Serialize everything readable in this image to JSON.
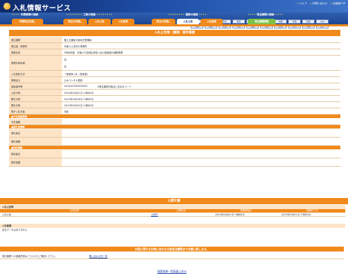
{
  "app": {
    "title": "入札情報サービス"
  },
  "top_links": [
    "ヘルプ",
    "お問い合わせ",
    "全画面TOP"
  ],
  "prefectures": [
    "全国",
    "北海道",
    "東北",
    "関東",
    "北陸",
    "中部",
    "近畿",
    "中国",
    "四国",
    "九州",
    "沖縄",
    "関東",
    "北陸",
    "中部",
    "近畿",
    "中国",
    "四国",
    "九州",
    "沖縄",
    "ほか"
  ],
  "sections": {
    "common": "年間情報の検索",
    "construction": "工事の検索",
    "business": "業務の検索",
    "ordering": "発注機関の検索"
  },
  "tabs": [
    "年間発注見通し",
    "発注の見通し",
    "入札公告",
    "入札結果",
    "発注の見通し",
    "入札公告",
    "入札結果",
    "発注機関情報"
  ],
  "main": {
    "header": "入札公告等（業務）案件概要",
    "rows": [
      {
        "label": "発注機関",
        "value": "国土交通省中部地方整備局"
      },
      {
        "label": "発注者・事務所",
        "value": "天竜川上流河川事務所"
      },
      {
        "label": "業務名称",
        "value": "令和6年度　天竜川中流地区添見ヶ谷川堰堤設計補助業務"
      },
      {
        "label": "業務対象地域",
        "line1": "自：",
        "line2": "至："
      },
      {
        "label": "入札契約方式",
        "value": "一般競争入札（簡素型）"
      },
      {
        "label": "業務区分",
        "value": "土木コンサル業務"
      },
      {
        "label": "調達番号等",
        "value": "2024007063920000",
        "note": "※発注機関が独自に定めるコード"
      },
      {
        "label": "公告日時",
        "value": "2024年04月01日 10時00分"
      },
      {
        "label": "開札日時",
        "value": "2024年04月16日 10時00分"
      },
      {
        "label": "開札日時",
        "value": "2024年05月20日 10時00分"
      },
      {
        "label": "電子入札対象",
        "value": "対象"
      }
    ],
    "sub1": "■予定価格情報",
    "rows2": [
      {
        "label": "予定価格",
        "value": ""
      }
    ],
    "sub2": "■落札者情報",
    "rows3": [
      {
        "label": "落札者名",
        "value": ""
      },
      {
        "label": "落札価格",
        "value": ""
      }
    ],
    "sub3": "■契約情報",
    "rows4": [
      {
        "label": "契約者名",
        "value": ""
      },
      {
        "label": "契約金額",
        "value": ""
      }
    ]
  },
  "public_docs": {
    "header": "公開文書",
    "notice_title": "入札公告等",
    "columns": [
      "文書名称",
      "公開状況",
      "掲載開始日",
      "掲載終了日"
    ],
    "rows": [
      {
        "name": "入札公告",
        "status": "公開中",
        "start": "2024年04月01日 10時00分",
        "end": "2025年03月31日 23時59分"
      }
    ],
    "result_title": "入札経過",
    "result_note": "該当データはありません"
  },
  "inquiry": {
    "header": "内容に関するお問い合わせは各発注機関までお願い致します。",
    "text": "発注機関への連絡先等はこちらからご確認ください。",
    "link": "問い合わせ先一覧"
  },
  "back_link": "検索結果一覧画面に戻る",
  "colors": {
    "accent": "#f08a1c",
    "header": "#1c4590",
    "label_bg": "#fde4c7"
  }
}
